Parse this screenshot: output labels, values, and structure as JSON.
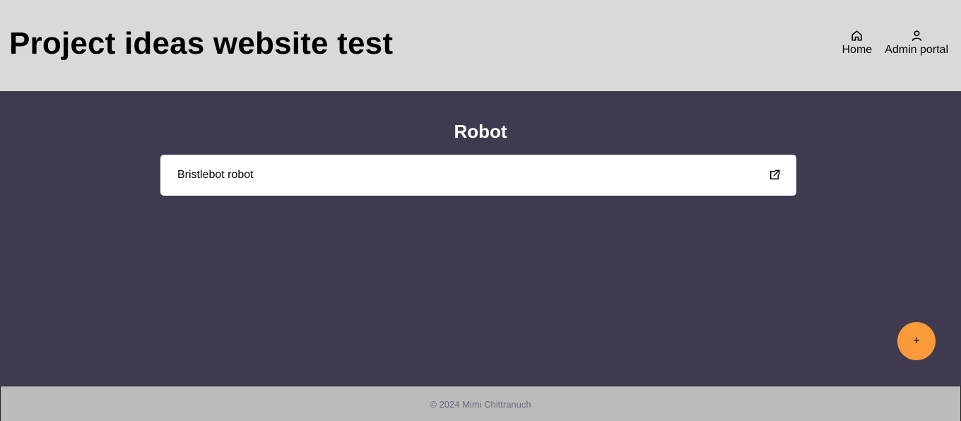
{
  "header": {
    "title": "Project ideas website test",
    "nav": [
      {
        "label": "Home",
        "icon": "home-icon"
      },
      {
        "label": "Admin portal",
        "icon": "user-icon"
      }
    ]
  },
  "main": {
    "section_title": "Robot",
    "items": [
      {
        "title": "Bristlebot robot",
        "icon": "external-link-icon"
      }
    ]
  },
  "fab": {
    "label": "+",
    "color": "#fb9a3a"
  },
  "footer": {
    "text": "© 2024 Mimi Chittranuch"
  },
  "colors": {
    "header_bg": "#d9d9d9",
    "main_bg": "#3f3a4f",
    "footer_bg": "#bbbbbb"
  }
}
